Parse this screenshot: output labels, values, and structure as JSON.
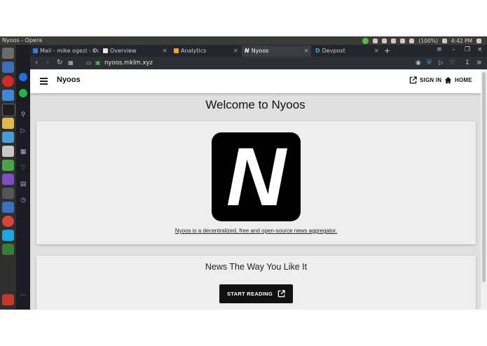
{
  "os": {
    "window_title": "Nyoos - Opera",
    "tray": {
      "battery": "(100%)",
      "clock": "4:42 PM"
    }
  },
  "browser": {
    "tabs": [
      {
        "label": "Mail - mike ogezi - Ou",
        "favicon_color": "#3b7cd8"
      },
      {
        "label": "Overview",
        "favicon_color": "#e6e6e6"
      },
      {
        "label": "Analytics",
        "favicon_color": "#f4a32b"
      },
      {
        "label": "Nyoos",
        "favicon_letter": "N",
        "active": true
      },
      {
        "label": "Devpost",
        "favicon_letter": "D",
        "favicon_color": "#4aa3d8"
      }
    ],
    "new_tab_icon": "plus-icon",
    "url": "nyoos.mklm.xyz"
  },
  "app": {
    "brand": "Nyoos",
    "nav": {
      "sign_in": "SIGN IN",
      "home": "HOME"
    },
    "welcome": "Welcome to Nyoos",
    "logo_letter": "N",
    "tagline": "Nyoos is a decentralized, free and open-source news aggregator.",
    "subheading": "News The Way You Like It",
    "cta": "START READING"
  },
  "colors": {
    "appbar": "#ffffff",
    "page_bg": "#e0e0e0",
    "card_bg": "#eeeeee",
    "logo_bg": "#000000",
    "button_bg": "#111111"
  }
}
